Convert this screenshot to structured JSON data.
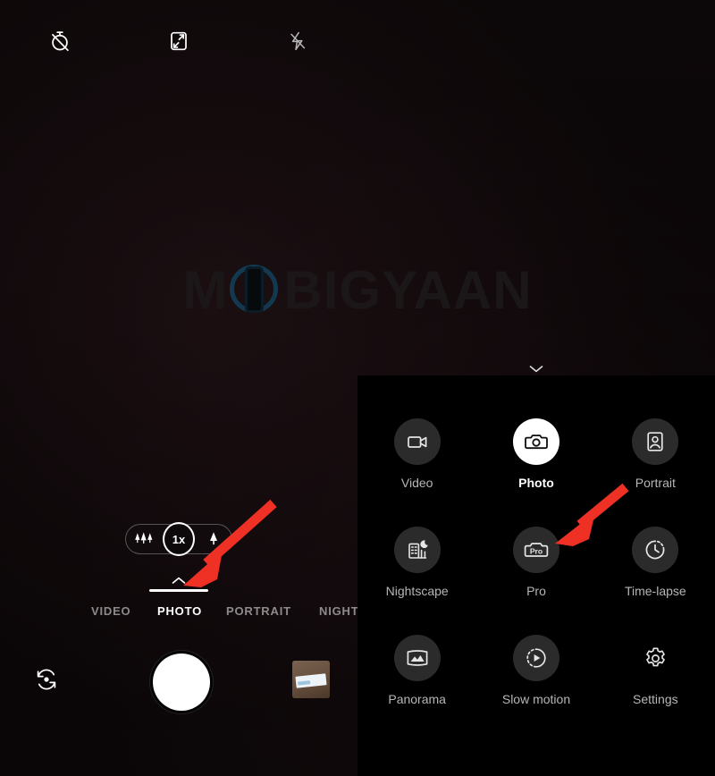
{
  "app": {
    "name": "Camera",
    "watermark_text_before": "M",
    "watermark_icon": "phone-in-circle-logo",
    "watermark_text_after": "BIGYAAN",
    "watermark_full": "MOBIGYAAN"
  },
  "colors": {
    "accent_arrow": "#ee3124",
    "active_mode_bg": "#ffffff",
    "mode_circle_bg": "#2b2b2b",
    "mode_label": "#b6b6b6",
    "panel_bg": "#000000",
    "viewfinder_bg": "#0b0607",
    "watermark_text": "#1b1718",
    "watermark_ring": "#12394f"
  },
  "viewfinder": {
    "top_bar": [
      {
        "id": "timer-off",
        "icon": "timer-off-icon",
        "label": "Timer off"
      },
      {
        "id": "aspect-ratio",
        "icon": "aspect-ratio-icon",
        "label": "Aspect ratio"
      },
      {
        "id": "flash-off",
        "icon": "flash-off-icon",
        "label": "Flash off"
      }
    ],
    "zoom": {
      "wide_icon": "trees-wide-icon",
      "level_label": "1x",
      "tele_icon": "tree-tele-icon"
    },
    "strip_handle_icon": "chevron-up-icon",
    "mode_tabs": [
      {
        "label": "VIDEO",
        "active": false
      },
      {
        "label": "PHOTO",
        "active": true
      },
      {
        "label": "PORTRAIT",
        "active": false
      },
      {
        "label": "NIGHTS",
        "active": false
      }
    ],
    "bottom_bar": {
      "switch_camera_icon": "switch-camera-icon",
      "shutter_label": "Shutter",
      "gallery_label": "Gallery"
    }
  },
  "mode_panel": {
    "collapse_icon": "chevron-down-icon",
    "rows": [
      [
        {
          "label": "Video",
          "icon": "video-camera-icon",
          "active": false,
          "bare": false
        },
        {
          "label": "Photo",
          "icon": "camera-icon",
          "active": true,
          "bare": false
        },
        {
          "label": "Portrait",
          "icon": "portrait-person-icon",
          "active": false,
          "bare": false
        }
      ],
      [
        {
          "label": "Nightscape",
          "icon": "night-building-moon-icon",
          "active": false,
          "bare": false
        },
        {
          "label": "Pro",
          "icon": "pro-camera-icon",
          "active": false,
          "bare": false
        },
        {
          "label": "Time-lapse",
          "icon": "timelapse-clock-icon",
          "active": false,
          "bare": false
        }
      ],
      [
        {
          "label": "Panorama",
          "icon": "panorama-image-icon",
          "active": false,
          "bare": false
        },
        {
          "label": "Slow motion",
          "icon": "slow-motion-play-icon",
          "active": false,
          "bare": false
        },
        {
          "label": "Settings",
          "icon": "gear-icon",
          "active": false,
          "bare": true
        }
      ]
    ]
  },
  "annotations": [
    {
      "id": "arrow-to-strip-handle",
      "points_to": "chevron-up-strip-handle"
    },
    {
      "id": "arrow-to-pro-mode",
      "points_to": "pro-mode-button"
    }
  ]
}
